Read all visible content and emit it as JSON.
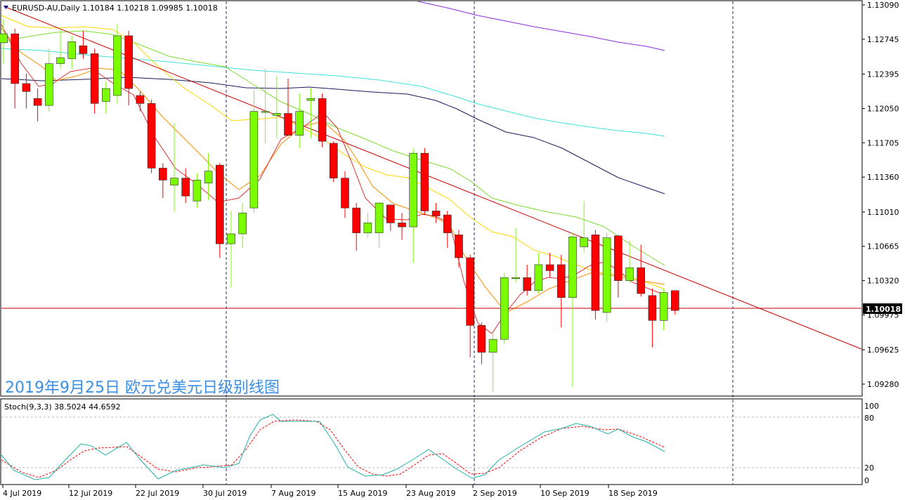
{
  "header": {
    "symbol_line": "EURUSD-AU,Daily  1.10184 1.10218 1.09985 1.10018"
  },
  "annotation": "2019年9月25日 欧元兑美元日级别线图",
  "price_badge": "1.10018",
  "colors": {
    "bull": "#7cfc00",
    "bear": "#ff0000",
    "trendline": "#cc0000",
    "price_line": "#cc0000",
    "ma_orange": "#ff8c00",
    "ma_yellow": "#ffd700",
    "ma_green": "#7fdd2f",
    "ma_cyan": "#40e0e0",
    "ma_navy": "#1a1a5c",
    "ma_purple": "#8a2be2",
    "stoch_main": "#20b2aa",
    "stoch_signal": "#ff0000",
    "annotation": "#3a8ee6"
  },
  "stoch": {
    "label": "Stoch(9,3,3) 38.5024 44.6592",
    "levels": [
      "100",
      "80",
      "20",
      "0"
    ]
  },
  "chart_data": {
    "type": "candlestick",
    "title": "EURUSD-AU,Daily",
    "ylim": [
      1.0905,
      1.1325
    ],
    "y_ticks": [
      "1.13090",
      "1.12745",
      "1.12395",
      "1.12050",
      "1.11705",
      "1.11360",
      "1.11010",
      "1.10665",
      "1.10320",
      "1.09975",
      "1.09625",
      "1.09280"
    ],
    "x_ticks": [
      "4 Jul 2019",
      "12 Jul 2019",
      "22 Jul 2019",
      "30 Jul 2019",
      "7 Aug 2019",
      "15 Aug 2019",
      "23 Aug 2019",
      "2 Sep 2019",
      "10 Sep 2019",
      "18 Sep 2019"
    ],
    "candles": [
      [
        1.1271,
        1.1295,
        1.125,
        1.128
      ],
      [
        1.128,
        1.1285,
        1.1205,
        1.123
      ],
      [
        1.123,
        1.124,
        1.1205,
        1.1222
      ],
      [
        1.1215,
        1.1225,
        1.1192,
        1.1208
      ],
      [
        1.1208,
        1.1265,
        1.1202,
        1.125
      ],
      [
        1.125,
        1.1285,
        1.1245,
        1.1256
      ],
      [
        1.1255,
        1.1278,
        1.1245,
        1.1272
      ],
      [
        1.1268,
        1.1283,
        1.1255,
        1.126
      ],
      [
        1.126,
        1.1265,
        1.12,
        1.121
      ],
      [
        1.1212,
        1.1232,
        1.12,
        1.1225
      ],
      [
        1.1218,
        1.129,
        1.121,
        1.1278
      ],
      [
        1.1278,
        1.1283,
        1.1208,
        1.1225
      ],
      [
        1.1218,
        1.1222,
        1.1202,
        1.121
      ],
      [
        1.121,
        1.1214,
        1.114,
        1.1145
      ],
      [
        1.1145,
        1.115,
        1.1115,
        1.1133
      ],
      [
        1.1128,
        1.119,
        1.1101,
        1.1135
      ],
      [
        1.1135,
        1.1145,
        1.111,
        1.1117
      ],
      [
        1.1112,
        1.114,
        1.1105,
        1.1133
      ],
      [
        1.113,
        1.116,
        1.1113,
        1.1142
      ],
      [
        1.1148,
        1.115,
        1.1055,
        1.1069
      ],
      [
        1.1069,
        1.1102,
        1.1025,
        1.1079
      ],
      [
        1.1079,
        1.111,
        1.1065,
        1.11
      ],
      [
        1.1105,
        1.1223,
        1.11,
        1.1202
      ],
      [
        1.1202,
        1.1245,
        1.117,
        1.1202
      ],
      [
        1.1198,
        1.1238,
        1.1175,
        1.12
      ],
      [
        1.12,
        1.1235,
        1.1178,
        1.1178
      ],
      [
        1.1178,
        1.122,
        1.1165,
        1.1202
      ],
      [
        1.1213,
        1.1225,
        1.1175,
        1.1215
      ],
      [
        1.1215,
        1.122,
        1.1166,
        1.1172
      ],
      [
        1.117,
        1.1172,
        1.1131,
        1.1135
      ],
      [
        1.1135,
        1.1142,
        1.1095,
        1.1105
      ],
      [
        1.1105,
        1.111,
        1.1062,
        1.108
      ],
      [
        1.108,
        1.11,
        1.1075,
        1.109
      ],
      [
        1.108,
        1.111,
        1.1065,
        1.111
      ],
      [
        1.1108,
        1.1108,
        1.1082,
        1.109
      ],
      [
        1.109,
        1.11,
        1.1073,
        1.1086
      ],
      [
        1.1086,
        1.1165,
        1.105,
        1.116
      ],
      [
        1.116,
        1.1165,
        1.1098,
        1.1102
      ],
      [
        1.1102,
        1.111,
        1.109,
        1.1097
      ],
      [
        1.1098,
        1.1102,
        1.1065,
        1.108
      ],
      [
        1.1078,
        1.1083,
        1.1045,
        1.1055
      ],
      [
        1.1055,
        1.1058,
        1.0955,
        1.0987
      ],
      [
        1.0987,
        1.099,
        1.0948,
        1.096
      ],
      [
        1.096,
        1.0978,
        1.092,
        1.0973
      ],
      [
        1.0973,
        1.104,
        1.0968,
        1.1035
      ],
      [
        1.1035,
        1.1085,
        1.103,
        1.1035
      ],
      [
        1.1035,
        1.1048,
        1.1017,
        1.1022
      ],
      [
        1.1022,
        1.106,
        1.1019,
        1.1048
      ],
      [
        1.1048,
        1.106,
        1.1035,
        1.1042
      ],
      [
        1.1048,
        1.1058,
        1.0985,
        1.1015
      ],
      [
        1.1015,
        1.108,
        1.0925,
        1.1076
      ],
      [
        1.1066,
        1.1112,
        1.106,
        1.1075
      ],
      [
        1.1078,
        1.1083,
        1.0993,
        1.1002
      ],
      [
        1.1,
        1.108,
        1.099,
        1.1075
      ],
      [
        1.1077,
        1.1078,
        1.1015,
        1.1032
      ],
      [
        1.1032,
        1.1072,
        1.103,
        1.1045
      ],
      [
        1.1045,
        1.1068,
        1.1016,
        1.1019
      ],
      [
        1.1017,
        1.1024,
        1.0965,
        1.0992
      ],
      [
        1.0992,
        1.1024,
        1.0982,
        1.102
      ],
      [
        1.1022,
        1.1022,
        1.0998,
        1.1002
      ]
    ]
  }
}
